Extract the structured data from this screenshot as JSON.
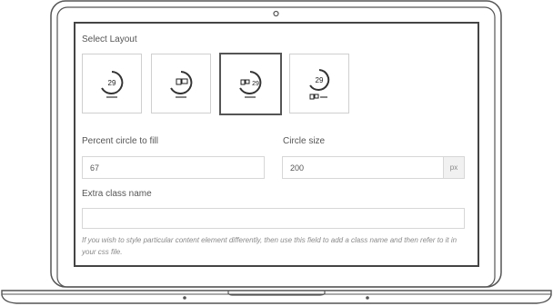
{
  "panel": {
    "select_layout_label": "Select Layout",
    "layouts": [
      {
        "name": "circle-number",
        "number": "29",
        "selected": false
      },
      {
        "name": "circle-icon",
        "icon": "monitor-icon",
        "selected": false
      },
      {
        "name": "circle-icon-number",
        "icon": "monitor-icon",
        "number": "29",
        "selected": true
      },
      {
        "name": "circle-number-icon-below",
        "number": "29",
        "icon": "monitor-icon",
        "selected": false
      }
    ],
    "percent_label": "Percent circle to fill",
    "percent_value": "67",
    "size_label": "Circle size",
    "size_value": "200",
    "size_unit": "px",
    "extra_class_label": "Extra class name",
    "extra_class_value": "",
    "help_text": "If you wish to style particular content element differently, then use this field to add a class name and then refer to it in your css file."
  },
  "colors": {
    "laptop_outline": "#555555",
    "border": "#d7d7d7",
    "selected_border": "#555555"
  }
}
